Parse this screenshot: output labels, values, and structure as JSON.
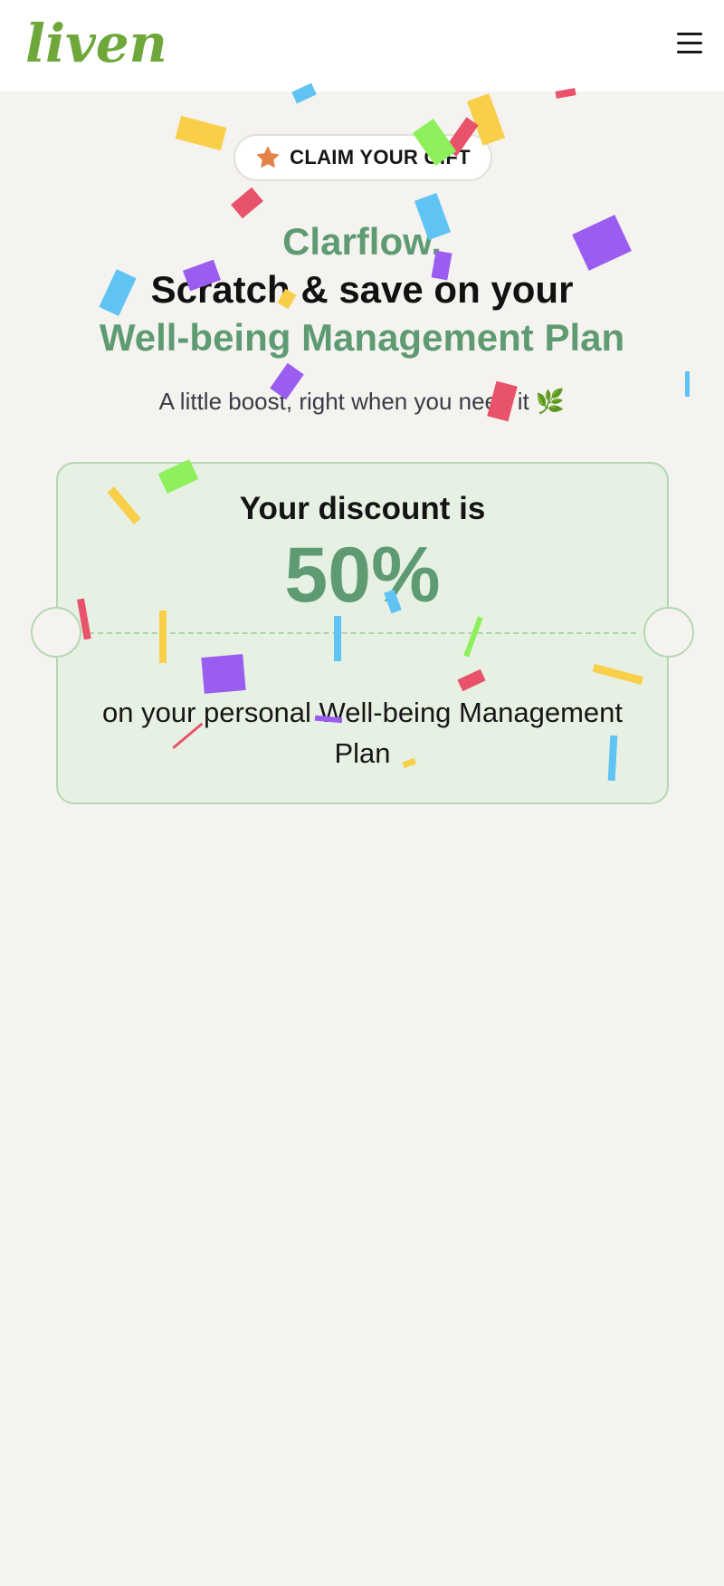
{
  "header": {
    "logo_text": "liven",
    "menu_icon": "hamburger-menu-icon",
    "logo_color": "#6fa83a"
  },
  "hero": {
    "badge_icon": "star-icon",
    "badge_label": "CLAIM YOUR GIFT",
    "greeting": "Clarflow,",
    "headline": "Scratch & save on your",
    "plan_name": "Well-being Management Plan",
    "subtitle": "A little boost, right when you need it 🌿"
  },
  "ticket": {
    "label": "Your discount is",
    "value": "50%",
    "description": "on your personal Well-being Management Plan"
  },
  "colors": {
    "accent_green": "#5f9b72",
    "ticket_bg": "#e6f1e4",
    "star_orange": "#e4844a",
    "confetti": [
      "#f9cf4a",
      "#5fc3f4",
      "#9b5cf0",
      "#e8526b",
      "#8ef05a"
    ]
  }
}
